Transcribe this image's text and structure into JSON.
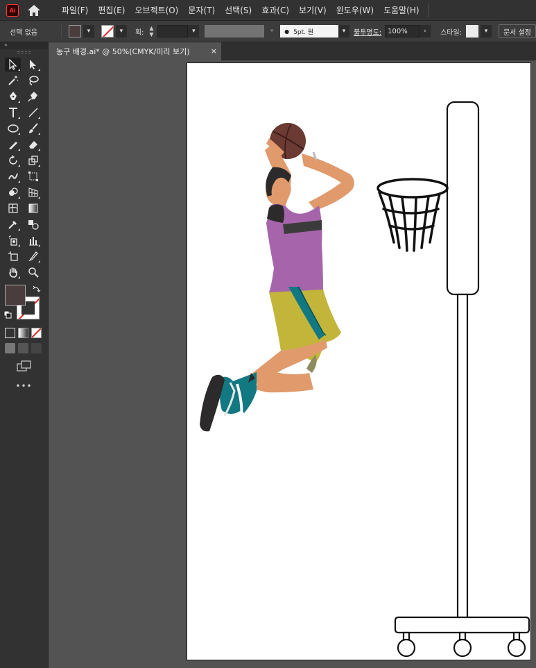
{
  "app": {
    "logo_text": "Ai"
  },
  "menu": {
    "items": [
      "파일(F)",
      "편집(E)",
      "오브젝트(O)",
      "문자(T)",
      "선택(S)",
      "효과(C)",
      "보기(V)",
      "윈도우(W)",
      "도움말(H)"
    ]
  },
  "control_bar": {
    "selection_label": "선택 없음",
    "fill_color": "#4a3d3d",
    "stroke_label": "획:",
    "brush_label": "5pt. 원",
    "opacity_label": "불투명도:",
    "opacity_value": "100%",
    "style_label": "스타일:",
    "doc_setup_label": "문서 설정"
  },
  "document": {
    "tab_title": "농구 배경.ai* @ 50%(CMYK/미리 보기)",
    "tab_close": "×"
  },
  "toolbar": {
    "collapse_label": "«",
    "more_label": "•••",
    "fill_color": "#4a3d3d",
    "tools": [
      "selection-tool-icon",
      "direct-selection-tool-icon",
      "magic-wand-tool-icon",
      "lasso-tool-icon",
      "pen-tool-icon",
      "curvature-tool-icon",
      "type-tool-icon",
      "line-tool-icon",
      "ellipse-tool-icon",
      "paintbrush-tool-icon",
      "pencil-tool-icon",
      "eraser-tool-icon",
      "rotate-tool-icon",
      "scale-tool-icon",
      "warp-tool-icon",
      "free-transform-tool-icon",
      "shape-builder-tool-icon",
      "perspective-grid-tool-icon",
      "mesh-tool-icon",
      "gradient-tool-icon",
      "eyedropper-tool-icon",
      "blend-tool-icon",
      "symbol-sprayer-tool-icon",
      "column-graph-tool-icon",
      "artboard-tool-icon",
      "slice-tool-icon",
      "hand-tool-icon",
      "zoom-tool-icon"
    ]
  },
  "colors": {
    "menubar": "#323232",
    "controlbar": "#3c3c3c",
    "canvas": "#535353",
    "artboard": "#ffffff",
    "shirt": "#a665ab",
    "shorts": "#c2b53a",
    "shoes": "#127982",
    "skin": "#e09a6c",
    "ball": "#6b3a33"
  }
}
